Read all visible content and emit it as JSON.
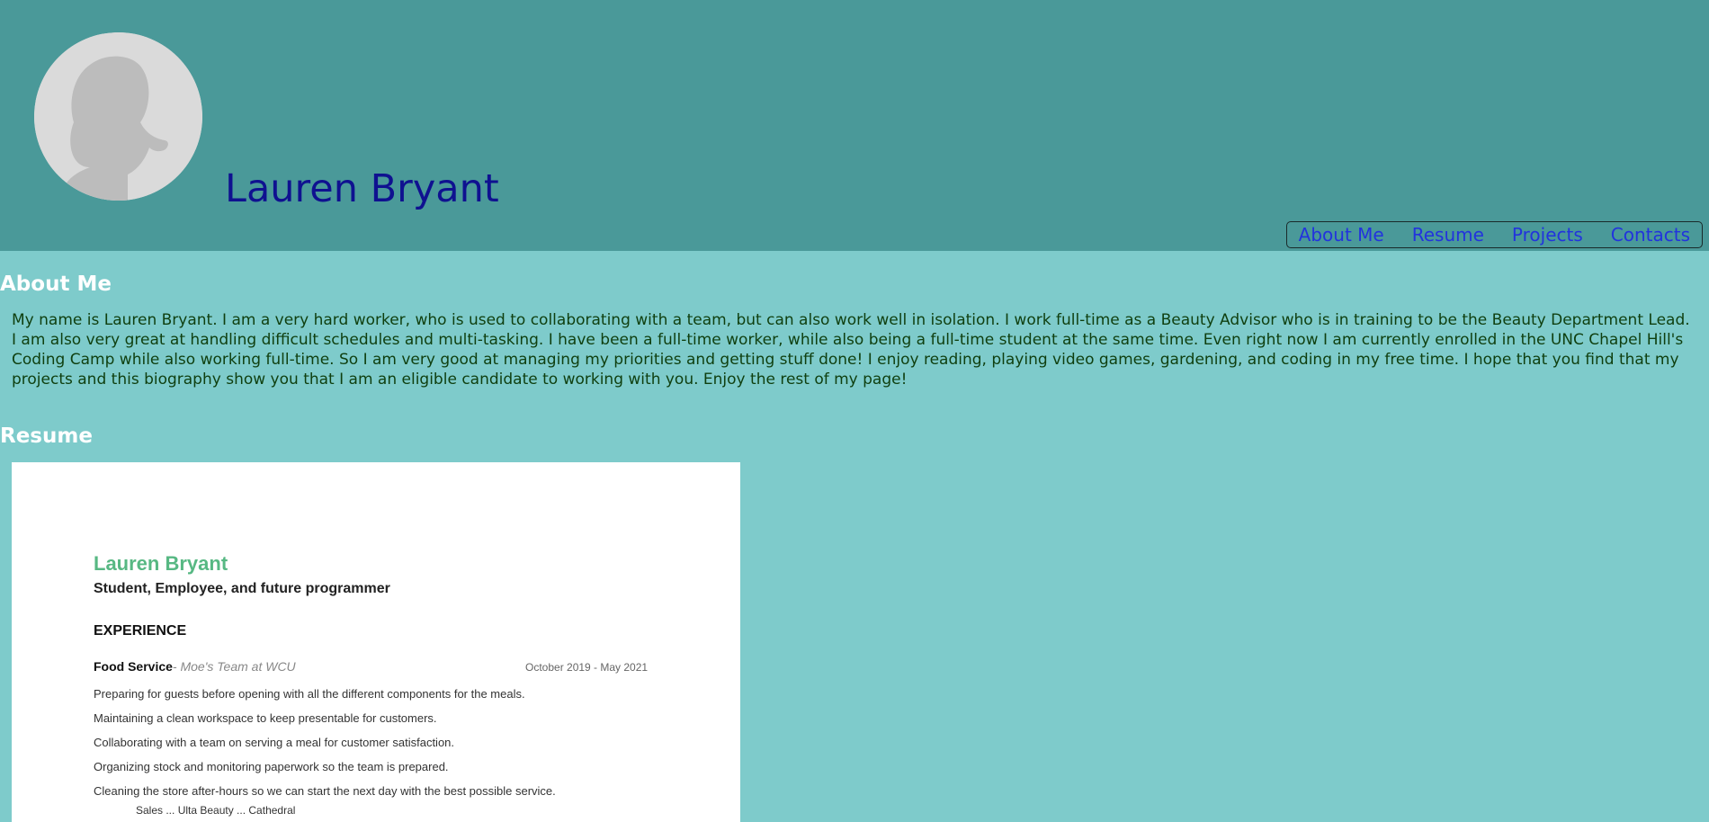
{
  "header": {
    "name": "Lauren Bryant",
    "avatar_icon": "person-silhouette-icon"
  },
  "nav": {
    "items": [
      "About Me",
      "Resume",
      "Projects",
      "Contacts"
    ]
  },
  "about": {
    "heading": "About Me",
    "text": "My name is Lauren Bryant. I am a very hard worker, who is used to collaborating with a team, but can also work well in isolation. I work full-time as a Beauty Advisor who is in training to be the Beauty Department Lead. I am also very great at handling difficult schedules and multi-tasking. I have been a full-time worker, while also being a full-time student at the same time. Even right now I am currently enrolled in the UNC Chapel Hill's Coding Camp while also working full-time. So I am very good at managing my priorities and getting stuff done! I enjoy reading, playing video games, gardening, and coding in my free time. I hope that you find that my projects and this biography show you that I am an eligible candidate to working with you. Enjoy the rest of my page!"
  },
  "resume": {
    "heading": "Resume",
    "doc": {
      "name": "Lauren Bryant",
      "tagline": "Student, Employee, and future programmer",
      "section": "EXPERIENCE",
      "job_title": "Food Service",
      "job_org": "- Moe's Team at WCU",
      "job_dates": "October 2019 - May 2021",
      "bullets": [
        "Preparing for guests before opening with all the different components for the meals.",
        "Maintaining a clean workspace to keep presentable for customers.",
        "Collaborating with a team on serving a meal for customer satisfaction.",
        "Organizing stock and monitoring paperwork so the team is prepared.",
        "Cleaning the store after-hours so we can start the next day with the best possible service."
      ],
      "cut_line": "Sales ... Ulta Beauty ... Cathedral"
    }
  },
  "colors": {
    "header_bg": "#4a9999",
    "page_bg": "#7ecbcb",
    "name": "#0f1190",
    "nav_link": "#2233dd",
    "bio_text": "#0f3f0f",
    "resume_name": "#57b883"
  }
}
